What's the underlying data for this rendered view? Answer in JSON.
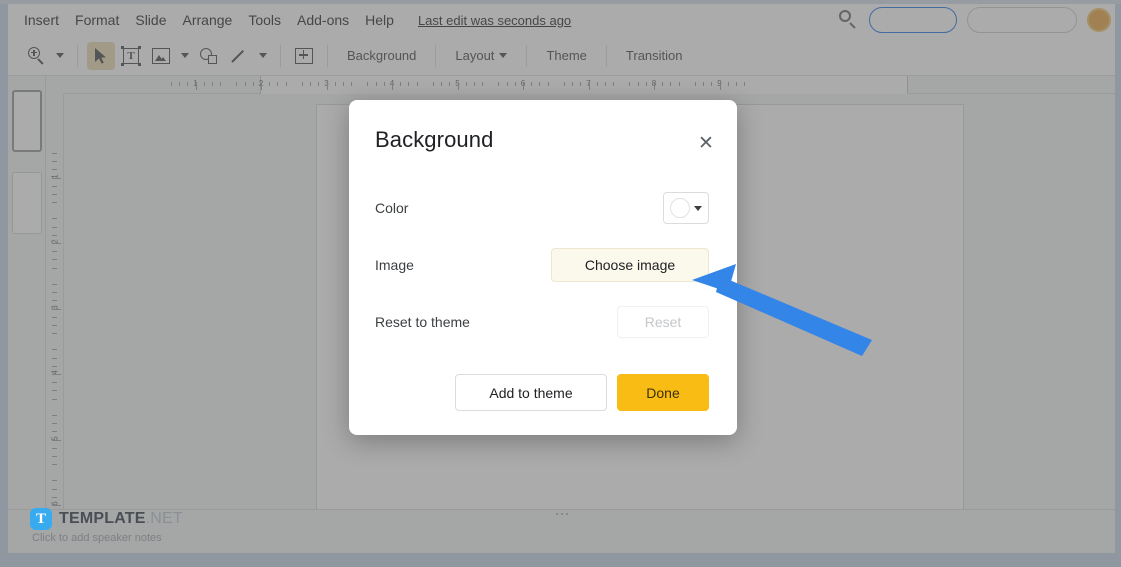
{
  "app": {
    "menubar": {
      "items": [
        "Insert",
        "Format",
        "Slide",
        "Arrange",
        "Tools",
        "Add-ons",
        "Help"
      ],
      "last_edit": "Last edit was seconds ago",
      "right": {
        "search_icon": "search-icon",
        "present_label": "",
        "share_label": "",
        "avatar": "avatar"
      }
    },
    "toolbar": {
      "zoom_icon": "zoom-icon",
      "select_icon": "select-cursor-icon",
      "textbox_icon": "text-box-icon",
      "textbox_glyph": "T",
      "image_icon": "insert-image-icon",
      "shape_icon": "insert-shape-icon",
      "line_icon": "insert-line-icon",
      "comment_icon": "add-comment-icon",
      "background_label": "Background",
      "layout_label": "Layout",
      "theme_label": "Theme",
      "transition_label": "Transition"
    },
    "rulers": {
      "horizontal_ticks": [
        "1",
        "2",
        "3",
        "4",
        "5",
        "6",
        "7",
        "8",
        "9"
      ],
      "vertical_ticks": [
        "1",
        "2",
        "3",
        "4",
        "5",
        "6"
      ]
    },
    "notes": {
      "placeholder": "Click to add speaker notes"
    },
    "watermark": {
      "logo_letter": "T",
      "name": "TEMPLATE",
      "tld": ".NET"
    }
  },
  "dialog": {
    "title": "Background",
    "close_icon": "✕",
    "rows": [
      {
        "label": "Color",
        "control": "color-swatch",
        "value": ""
      },
      {
        "label": "Image",
        "control": "button",
        "value": "Choose image"
      },
      {
        "label": "Reset to theme",
        "control": "button",
        "value": "Reset"
      }
    ],
    "footer": {
      "secondary_label": "Add to theme",
      "primary_label": "Done"
    }
  },
  "annotation": {
    "arrow": "blue-pointer-arrow",
    "arrow_color": "#3385e8",
    "points_to": "Choose image"
  },
  "colors": {
    "primary_button": "#f9bc15",
    "accent_blue": "#3385e8",
    "dialog_bg": "#ffffff",
    "hover_button": "#fbf8ec",
    "watermark_blue": "#37aaf0"
  }
}
